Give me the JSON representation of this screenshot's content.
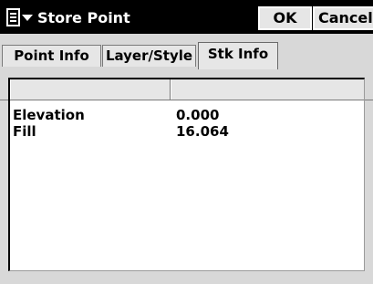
{
  "titlebar": {
    "title": "Store Point",
    "ok_label": "OK",
    "cancel_label": "Cancel"
  },
  "tabs": [
    {
      "label": "Point Info",
      "selected": false
    },
    {
      "label": "Layer/Style",
      "selected": false
    },
    {
      "label": "Stk Info",
      "selected": true
    }
  ],
  "table": {
    "headers": [
      "",
      ""
    ],
    "rows": [
      {
        "name": "Elevation",
        "value": "0.000"
      },
      {
        "name": "Fill",
        "value": "16.064"
      }
    ]
  },
  "icons": {
    "menu": "start-menu-icon",
    "dropdown": "chevron-down-icon"
  },
  "colors": {
    "titlebar_bg": "#000000",
    "window_bg": "#d8d8d8",
    "button_bg": "#e6e6e6"
  }
}
